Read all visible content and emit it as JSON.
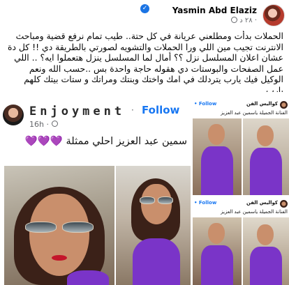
{
  "post": {
    "author": "Yasmin Abd Elaziz",
    "verified_mark": "✓",
    "meta": "٢٨ د ·",
    "caption": "الحملات بدأت ومطلعني عريانة في كل حتة.. طيب تمام نرفع قضية ومباحث الانترنت تجيب مين اللي ورا الحملات والتشويه لصورتي بالطريقة دي !! كل دة عشان اعلان المسلسل نزل ؟؟ أمال لما المسلسل ينزل هتعملوا ايه؟ .. اللي عمل الصفحات والبوستات دي هقوله حاجة واحدة بس ..حسب الله ونعم الوكيل فيك يارب يتردلك في امك واختك وبنتك ومراتك و ستات بيتك كلهم يارب"
  },
  "screenshot_main": {
    "page_name": "Enjoyment",
    "separator": "·",
    "follow_label": "Follow",
    "time": "16h ·",
    "headline": "سمين عبد العزيز احلي ممثلة",
    "hearts": "💜💜💜"
  },
  "screenshot_side_top": {
    "page_name": "كواليس الفن",
    "follow_label": "• Follow",
    "caption": "الفنانة الجميلة ياسمين عبد العزيز"
  },
  "screenshot_side_bottom": {
    "page_name": "كواليس الفن",
    "follow_label": "• Follow",
    "caption": "الفنانة الجميلة ياسمين عبد العزيز"
  },
  "colors": {
    "link_blue": "#1877f2",
    "verified_blue": "#1b74e4",
    "meta_gray": "#65676b",
    "dress_purple": "#7a34c8"
  }
}
